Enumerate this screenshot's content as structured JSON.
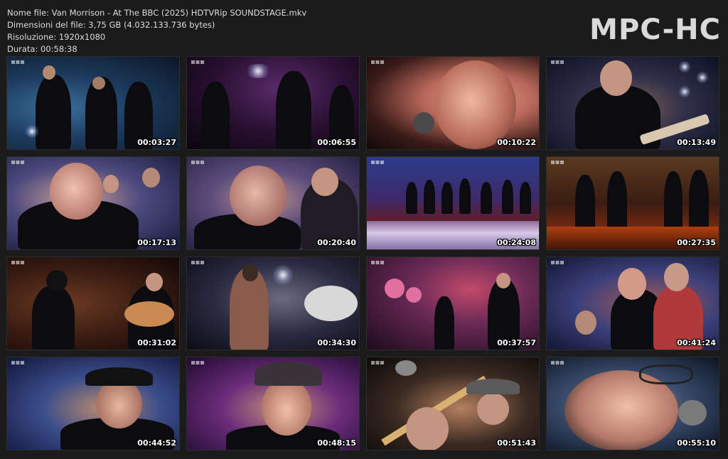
{
  "info": {
    "filename": "Nome file: Van Morrison - At The BBC (2025) HDTVRip SOUNDSTAGE.mkv",
    "filesize": "Dimensioni del file: 3,75 GB (4.032.133.736 bytes)",
    "resolution": "Risoluzione: 1920x1080",
    "duration": "Durata: 00:58:38"
  },
  "logo": "MPC-HC",
  "thumbnails": [
    {
      "time": "00:03:27"
    },
    {
      "time": "00:06:55"
    },
    {
      "time": "00:10:22"
    },
    {
      "time": "00:13:49"
    },
    {
      "time": "00:17:13"
    },
    {
      "time": "00:20:40"
    },
    {
      "time": "00:24:08"
    },
    {
      "time": "00:27:35"
    },
    {
      "time": "00:31:02"
    },
    {
      "time": "00:34:30"
    },
    {
      "time": "00:37:57"
    },
    {
      "time": "00:41:24"
    },
    {
      "time": "00:44:52"
    },
    {
      "time": "00:48:15"
    },
    {
      "time": "00:51:43"
    },
    {
      "time": "00:55:10"
    }
  ]
}
